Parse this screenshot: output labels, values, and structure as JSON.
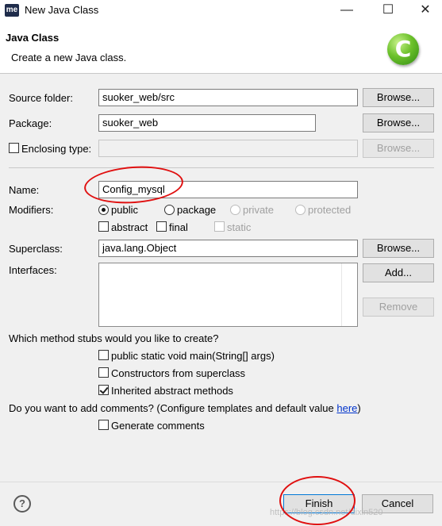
{
  "window": {
    "app_icon": "me",
    "title": "New Java Class",
    "controls": {
      "minimize": "—",
      "maximize": "☐",
      "close": "✕"
    }
  },
  "header": {
    "title": "Java Class",
    "subtitle": "Create a new Java class.",
    "logo_letter": "C"
  },
  "form": {
    "source_folder": {
      "label": "Source folder:",
      "value": "suoker_web/src",
      "browse": "Browse..."
    },
    "package": {
      "label": "Package:",
      "value": "suoker_web",
      "browse": "Browse..."
    },
    "enclosing_type": {
      "label": "Enclosing type:",
      "value": "",
      "checked": false,
      "browse": "Browse..."
    },
    "name": {
      "label": "Name:",
      "value": "Config_mysql"
    },
    "modifiers": {
      "label": "Modifiers:",
      "access": [
        {
          "label": "public",
          "selected": true,
          "enabled": true
        },
        {
          "label": "package",
          "selected": false,
          "enabled": true
        },
        {
          "label": "private",
          "selected": false,
          "enabled": false
        },
        {
          "label": "protected",
          "selected": false,
          "enabled": false
        }
      ],
      "flags": [
        {
          "label": "abstract",
          "checked": false,
          "enabled": true
        },
        {
          "label": "final",
          "checked": false,
          "enabled": true
        },
        {
          "label": "static",
          "checked": false,
          "enabled": false
        }
      ]
    },
    "superclass": {
      "label": "Superclass:",
      "value": "java.lang.Object",
      "browse": "Browse..."
    },
    "interfaces": {
      "label": "Interfaces:",
      "add": "Add...",
      "remove": "Remove"
    },
    "stubs": {
      "question": "Which method stubs would you like to create?",
      "options": [
        {
          "label": "public static void main(String[] args)",
          "checked": false
        },
        {
          "label": "Constructors from superclass",
          "checked": false
        },
        {
          "label": "Inherited abstract methods",
          "checked": true
        }
      ]
    },
    "comments": {
      "question": "Do you want to add comments? (Configure templates and default value ",
      "link": "here",
      "question_end": ")",
      "option": {
        "label": "Generate comments",
        "checked": false
      }
    }
  },
  "footer": {
    "help_icon": "?",
    "finish": "Finish",
    "cancel": "Cancel",
    "watermark": "https://blog.csdn.net/dixin520"
  },
  "colors": {
    "annotation_red": "#e01010",
    "logo_green": "#4caf1f",
    "link_blue": "#0033cc"
  }
}
